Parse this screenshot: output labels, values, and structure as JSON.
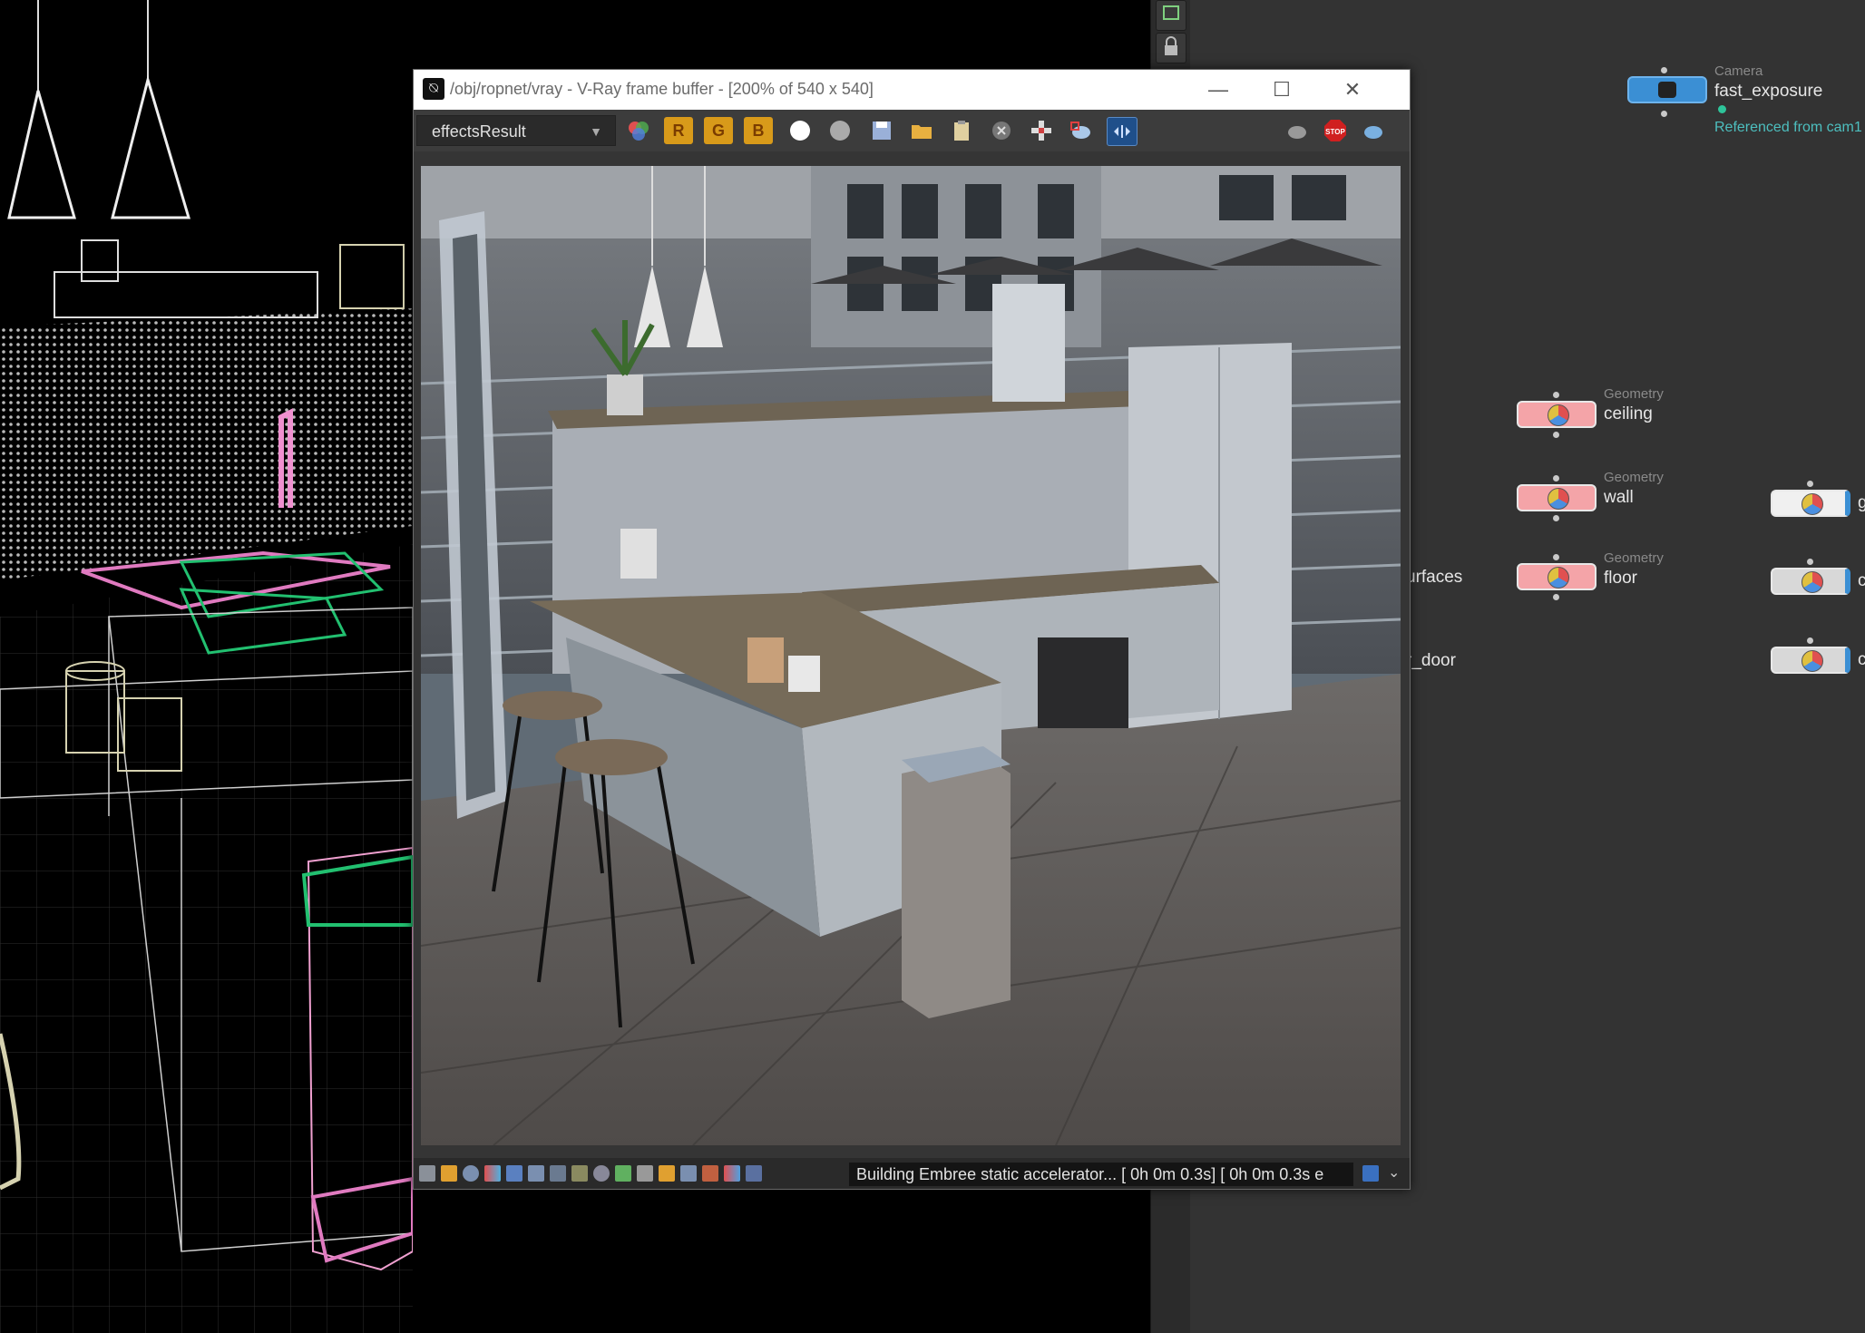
{
  "vfb": {
    "title": "/obj/ropnet/vray - V-Ray frame buffer - [200% of 540 x 540]",
    "channel": "effectsResult",
    "channel_buttons": [
      "R",
      "G",
      "B"
    ],
    "window_controls": {
      "minimize": "—",
      "maximize": "☐",
      "close": "✕"
    },
    "status": "Building Embree static accelerator... [ 0h  0m  0.3s] [ 0h  0m  0.3s e",
    "stop_label": "STOP"
  },
  "network": {
    "camera": {
      "type": "Camera",
      "name": "fast_exposure",
      "note": "Referenced from cam1"
    },
    "geometry_nodes": [
      {
        "type": "Geometry",
        "name": "ceiling"
      },
      {
        "type": "Geometry",
        "name": "wall"
      },
      {
        "type": "Geometry",
        "name": "floor"
      }
    ],
    "cut_labels": [
      "urfaces",
      "r_door"
    ],
    "right_node_cut": [
      "g",
      "c",
      "c"
    ]
  },
  "colors": {
    "geometry_node": "#f4a4a8",
    "camera_node": "#3b8fd4",
    "network_bg": "#333333",
    "accent_orange": "#d89a1a"
  }
}
